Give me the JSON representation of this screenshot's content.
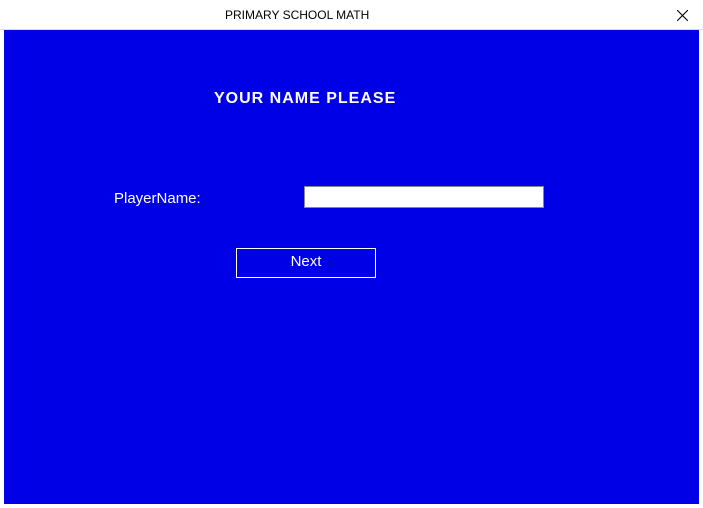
{
  "window": {
    "title": "PRIMARY SCHOOL MATH"
  },
  "form": {
    "heading": "YOUR NAME PLEASE",
    "playerNameLabel": "PlayerName:",
    "playerNameValue": "",
    "nextButtonLabel": "Next"
  }
}
